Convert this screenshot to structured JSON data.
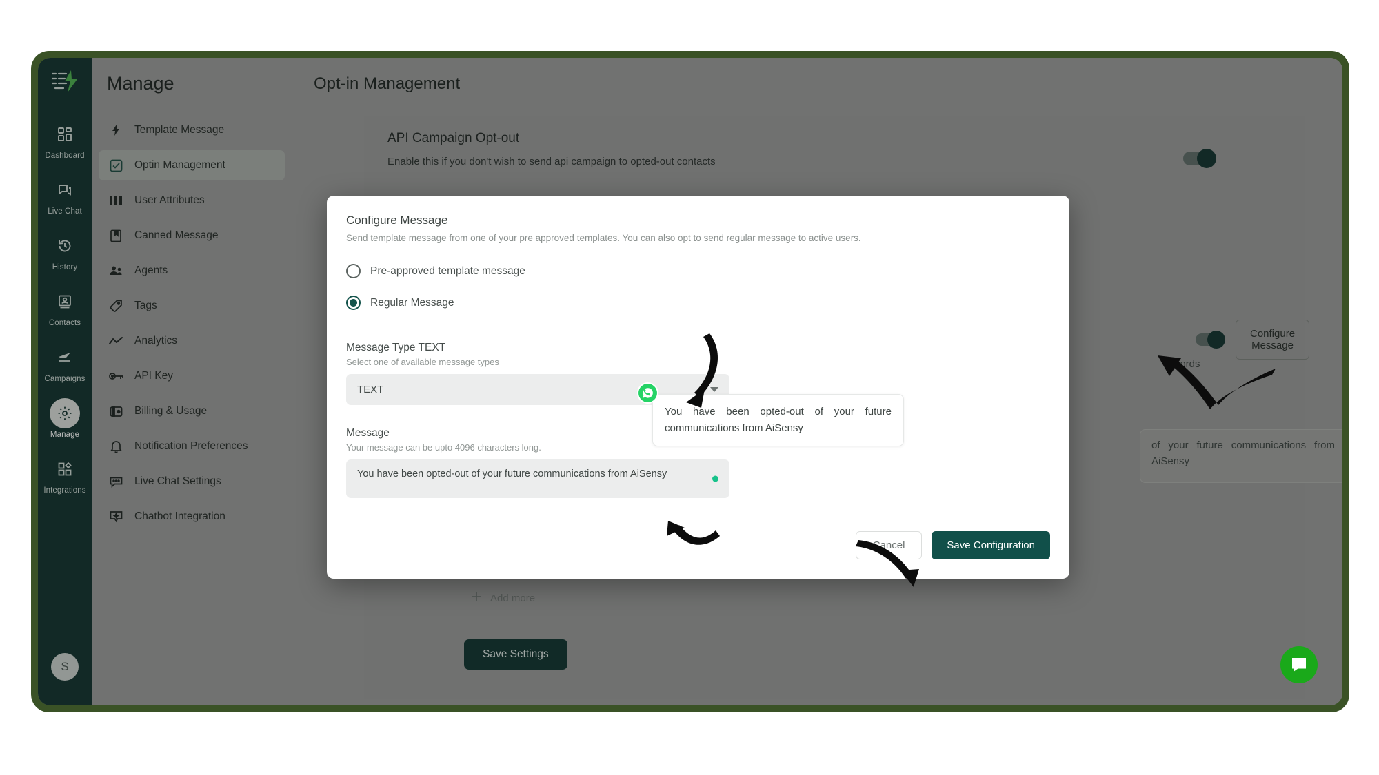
{
  "rail": {
    "logo_icon": "aisensy-logo-icon",
    "items": [
      {
        "label": "Dashboard",
        "icon": "dashboard-icon",
        "active": false
      },
      {
        "label": "Live Chat",
        "icon": "chat-icon",
        "active": false
      },
      {
        "label": "History",
        "icon": "history-icon",
        "active": false
      },
      {
        "label": "Contacts",
        "icon": "contacts-icon",
        "active": false
      },
      {
        "label": "Campaigns",
        "icon": "campaigns-icon",
        "active": false
      },
      {
        "label": "Manage",
        "icon": "gear-icon",
        "active": true
      },
      {
        "label": "Integrations",
        "icon": "integrations-icon",
        "active": false
      }
    ],
    "avatar_initial": "S"
  },
  "subnav": {
    "title": "Manage",
    "items": [
      {
        "label": "Template Message",
        "icon": "bolt-icon",
        "active": false
      },
      {
        "label": "Optin Management",
        "icon": "checkbox-icon",
        "active": true
      },
      {
        "label": "User Attributes",
        "icon": "columns-icon",
        "active": false
      },
      {
        "label": "Canned Message",
        "icon": "bookmark-icon",
        "active": false
      },
      {
        "label": "Agents",
        "icon": "agents-icon",
        "active": false
      },
      {
        "label": "Tags",
        "icon": "tag-icon",
        "active": false
      },
      {
        "label": "Analytics",
        "icon": "analytics-icon",
        "active": false
      },
      {
        "label": "API Key",
        "icon": "key-icon",
        "active": false
      },
      {
        "label": "Billing & Usage",
        "icon": "wallet-icon",
        "active": false
      },
      {
        "label": "Notification Preferences",
        "icon": "bell-icon",
        "active": false
      },
      {
        "label": "Live Chat Settings",
        "icon": "chat-settings-icon",
        "active": false
      },
      {
        "label": "Chatbot Integration",
        "icon": "chatbot-icon",
        "active": false
      }
    ]
  },
  "page": {
    "title": "Opt-in Management",
    "section_title": "API Campaign Opt-out",
    "section_subtitle": "Enable this if you don't wish to send api campaign to opted-out contacts",
    "keywords_partial": "ywords",
    "configure_message_label": "Configure Message",
    "bubble_text": "of your future communications from AiSensy",
    "add_more_label": "Add more",
    "add_more_icon": "plus-icon",
    "save_settings_label": "Save Settings"
  },
  "modal": {
    "title": "Configure Message",
    "subtitle": "Send template message from one of your pre approved templates. You can also opt to send regular message to active users.",
    "radio_options": [
      {
        "label": "Pre-approved template message",
        "selected": false
      },
      {
        "label": "Regular Message",
        "selected": true
      }
    ],
    "message_type": {
      "label": "Message Type TEXT",
      "hint": "Select one of available message types",
      "value": "TEXT",
      "caret_icon": "chevron-down-icon"
    },
    "message": {
      "label": "Message",
      "hint": "Your message can be upto 4096 characters long.",
      "value": "You have been opted-out of your future communications from AiSensy",
      "status_icon": "status-dot-icon"
    },
    "preview": {
      "icon": "whatsapp-icon",
      "text": "You have been opted-out of your future communications from AiSensy"
    },
    "cancel_label": "Cancel",
    "save_label": "Save Configuration"
  },
  "chat_widget": {
    "icon": "intercom-chat-icon"
  },
  "colors": {
    "brand_dark": "#12322f",
    "accent_teal": "#15544c",
    "frame_green": "#3a5226",
    "whatsapp_green": "#25d366",
    "status_dot": "#17c28a",
    "chat_widget_green": "#1aa91a"
  }
}
